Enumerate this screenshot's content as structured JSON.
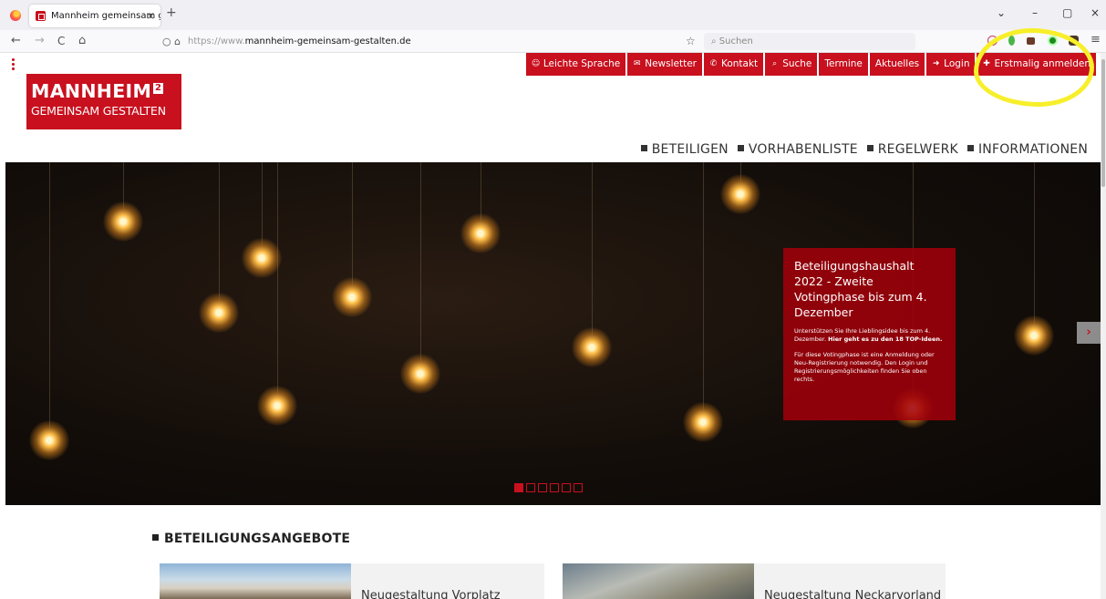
{
  "browser": {
    "tab_title": "Mannheim gemeinsam gestalt",
    "tab_close": "×",
    "new_tab": "+",
    "url_prefix": "https://www.",
    "url_host": "mannheim-gemeinsam-gestalten.de",
    "search_placeholder": "Suchen",
    "window_controls": {
      "list": "⌄",
      "minimize": "–",
      "maximize": "▢",
      "close": "×"
    },
    "nav": {
      "back": "←",
      "forward": "→",
      "reload": "C",
      "home": "⌂",
      "menu": "≡",
      "star": "☆"
    }
  },
  "site": {
    "logo_title": "MANNHEIM",
    "logo_sup": "2",
    "logo_sub": "GEMEINSAM GESTALTEN",
    "top_nav": [
      {
        "label": "Leichte Sprache",
        "icon": "easy-language-icon",
        "glyph": "☺"
      },
      {
        "label": "Newsletter",
        "icon": "envelope-icon",
        "glyph": "✉"
      },
      {
        "label": "Kontakt",
        "icon": "phone-icon",
        "glyph": "✆"
      },
      {
        "label": "Suche",
        "icon": "search-icon",
        "glyph": "⌕"
      },
      {
        "label": "Termine",
        "icon": "",
        "glyph": ""
      },
      {
        "label": "Aktuelles",
        "icon": "",
        "glyph": ""
      },
      {
        "label": "Login",
        "icon": "login-icon",
        "glyph": "➜"
      },
      {
        "label": "Erstmalig anmelden",
        "icon": "add-user-icon",
        "glyph": "✚"
      }
    ],
    "main_nav": [
      "BETEILIGEN",
      "VORHABENLISTE",
      "REGELWERK",
      "INFORMATIONEN"
    ]
  },
  "hero": {
    "title": "Beteiligungshaushalt 2022 - Zweite Votingphase bis zum 4. Dezember",
    "text_1": "Unterstützen Sie Ihre Lieblingsidee bis zum 4. Dezember. ",
    "text_1_bold": "Hier geht es zu den 18 TOP-Ideen.",
    "text_2": "Für diese Votingphase ist eine Anmeldung oder Neu-Registrierung notwendig. Den Login und Registrierungsmöglichkeiten finden Sie oben rechts.",
    "next": "›",
    "slide_count": 6,
    "active_slide": 1
  },
  "section": {
    "title": "BETEILIGUNGSANGEBOTE",
    "cards": [
      {
        "title": "Neugestaltung Vorplatz"
      },
      {
        "title": "Neugestaltung Neckarvorland"
      }
    ]
  },
  "colors": {
    "brand_red": "#c8101e",
    "annotation_yellow": "#f7ef2a"
  }
}
